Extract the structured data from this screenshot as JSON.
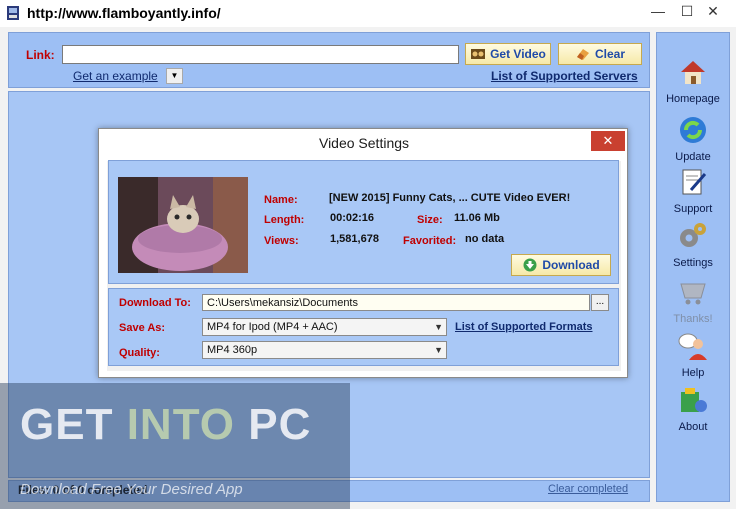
{
  "window": {
    "title": "http://www.flamboyantly.info/",
    "min_glyph": "—",
    "max_glyph": "☐",
    "close_glyph": "✕"
  },
  "link_bar": {
    "label": "Link:",
    "input_value": "",
    "get_video_label": "Get Video",
    "clear_label": "Clear",
    "example_link": "Get an example",
    "servers_link": "List of Supported Servers"
  },
  "sidebar": {
    "items": [
      {
        "label": "Homepage",
        "icon": "home-icon"
      },
      {
        "label": "Update",
        "icon": "update-icon"
      },
      {
        "label": "Support",
        "icon": "support-icon"
      },
      {
        "label": "Settings",
        "icon": "settings-icon"
      },
      {
        "label": "Thanks!",
        "icon": "cart-icon"
      },
      {
        "label": "Help",
        "icon": "help-icon"
      },
      {
        "label": "About",
        "icon": "about-icon"
      }
    ]
  },
  "dialog": {
    "title": "Video Settings",
    "close_glyph": "✕",
    "name_label": "Name:",
    "name_value": "[NEW 2015] Funny Cats, ... CUTE Video EVER!",
    "length_label": "Length:",
    "length_value": "00:02:16",
    "size_label": "Size:",
    "size_value": "11.06 Mb",
    "views_label": "Views:",
    "views_value": "1,581,678",
    "favorited_label": "Favorited:",
    "favorited_value": "no data",
    "download_button": "Download",
    "download_to_label": "Download To:",
    "download_to_value": "C:\\Users\\mekansiz\\Documents",
    "browse_label": "...",
    "save_as_label": "Save As:",
    "save_as_value": "MP4 for Ipod (MP4 + AAC)",
    "formats_link": "List of Supported Formats",
    "quality_label": "Quality:",
    "quality_value": "MP4 360p"
  },
  "status": {
    "files_text": "Files: 0 of 0 completed",
    "clear_completed": "Clear completed"
  },
  "watermark": {
    "get": "GET ",
    "into": "INTO",
    "pc": " PC",
    "tagline": "Download Free Your Desired App"
  },
  "colors": {
    "panel_blue": "#9dbff4",
    "label_red": "#c00000",
    "link_navy": "#102a6e",
    "button_gold": "#f6e9a8"
  }
}
